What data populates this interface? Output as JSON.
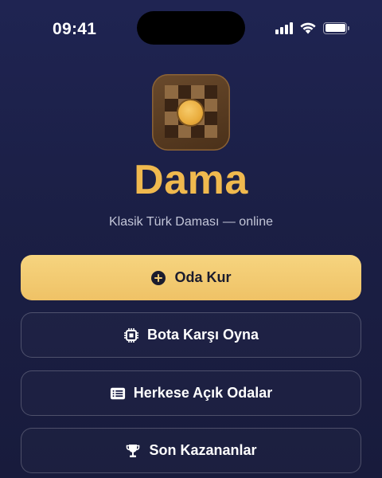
{
  "status_bar": {
    "time": "09:41",
    "icons": [
      "cellular-signal-icon",
      "wifi-icon",
      "battery-icon"
    ]
  },
  "app": {
    "logo_icon": "checkerboard-coin-icon",
    "title": "Dama",
    "subtitle": "Klasik Türk Daması — online"
  },
  "buttons": {
    "create_room": {
      "label": "Oda Kur",
      "icon": "plus-circle-icon"
    },
    "play_bot": {
      "label": "Bota Karşı Oyna",
      "icon": "cpu-chip-icon"
    },
    "open_rooms": {
      "label": "Herkese Açık Odalar",
      "icon": "list-icon"
    },
    "winners": {
      "label": "Son Kazananlar",
      "icon": "trophy-icon"
    }
  },
  "colors": {
    "background": "#1f2452",
    "accent_gold": "#f0b94e",
    "primary_button": "#f3cb72",
    "logo_brown": "#5a3d22"
  }
}
